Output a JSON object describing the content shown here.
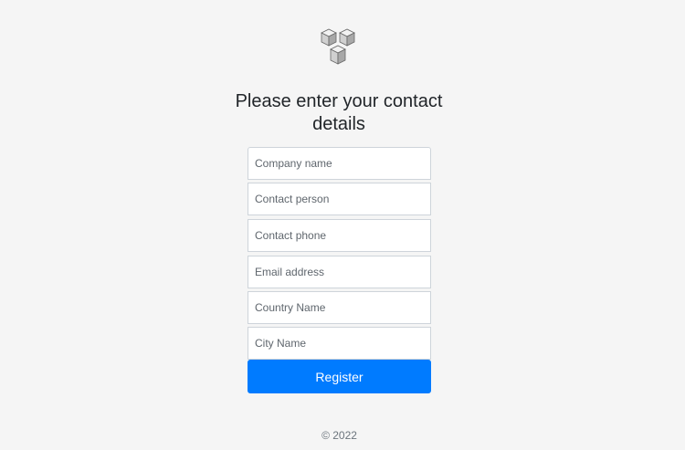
{
  "logo": {
    "icon": "cubes-logo-icon"
  },
  "form": {
    "heading": "Please enter your contact details",
    "fields": [
      {
        "name": "company",
        "placeholder": "Company name",
        "value": ""
      },
      {
        "name": "contact_person",
        "placeholder": "Contact person",
        "value": ""
      },
      {
        "name": "contact_phone",
        "placeholder": "Contact phone",
        "value": ""
      },
      {
        "name": "email",
        "placeholder": "Email address",
        "value": ""
      },
      {
        "name": "country",
        "placeholder": "Country Name",
        "value": ""
      },
      {
        "name": "city",
        "placeholder": "City Name",
        "value": ""
      }
    ],
    "submit_label": "Register"
  },
  "colors": {
    "background": "#f5f5f5",
    "primary": "#007bff",
    "border": "#ced4da"
  },
  "footer": {
    "text": "© 2022"
  }
}
